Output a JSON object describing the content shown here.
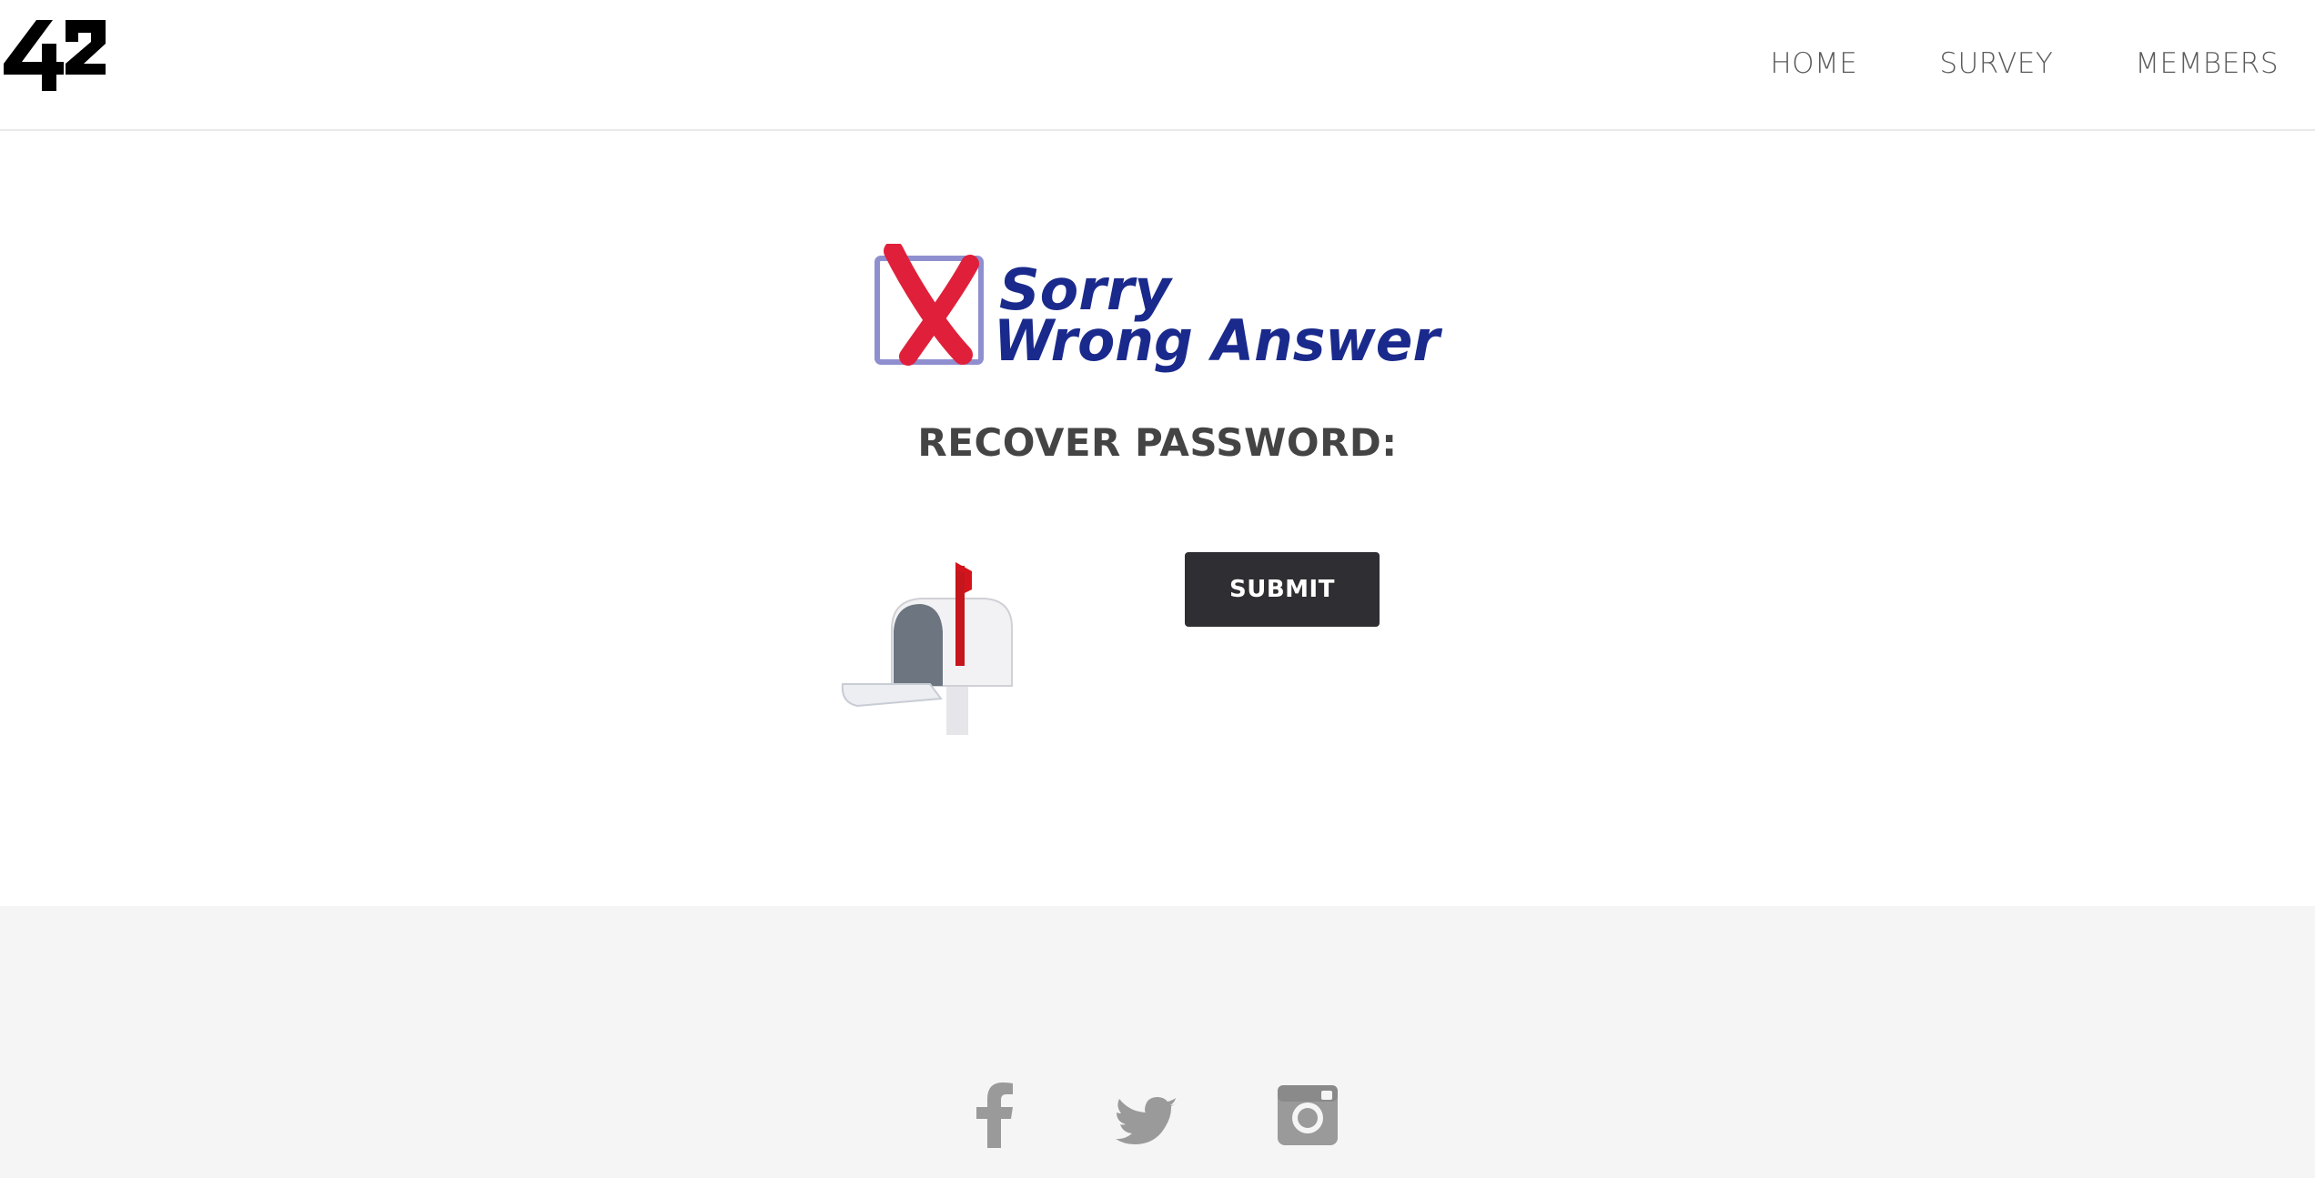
{
  "header": {
    "logo_text": "42",
    "nav": [
      {
        "label": "HOME"
      },
      {
        "label": "SURVEY"
      },
      {
        "label": "MEMBERS"
      }
    ]
  },
  "banner": {
    "line1": "Sorry",
    "line2": "Wrong Answer"
  },
  "main": {
    "title": "RECOVER PASSWORD:",
    "submit_label": "SUBMIT"
  },
  "footer": {
    "social": [
      {
        "icon": "facebook-icon"
      },
      {
        "icon": "twitter-icon"
      },
      {
        "icon": "instagram-icon"
      }
    ]
  },
  "colors": {
    "banner_text": "#1a2a8c",
    "x_mark": "#e0203a",
    "button_bg": "#2f2f33",
    "footer_bg": "#f5f5f5",
    "social_icons": "#9a9a9a"
  }
}
